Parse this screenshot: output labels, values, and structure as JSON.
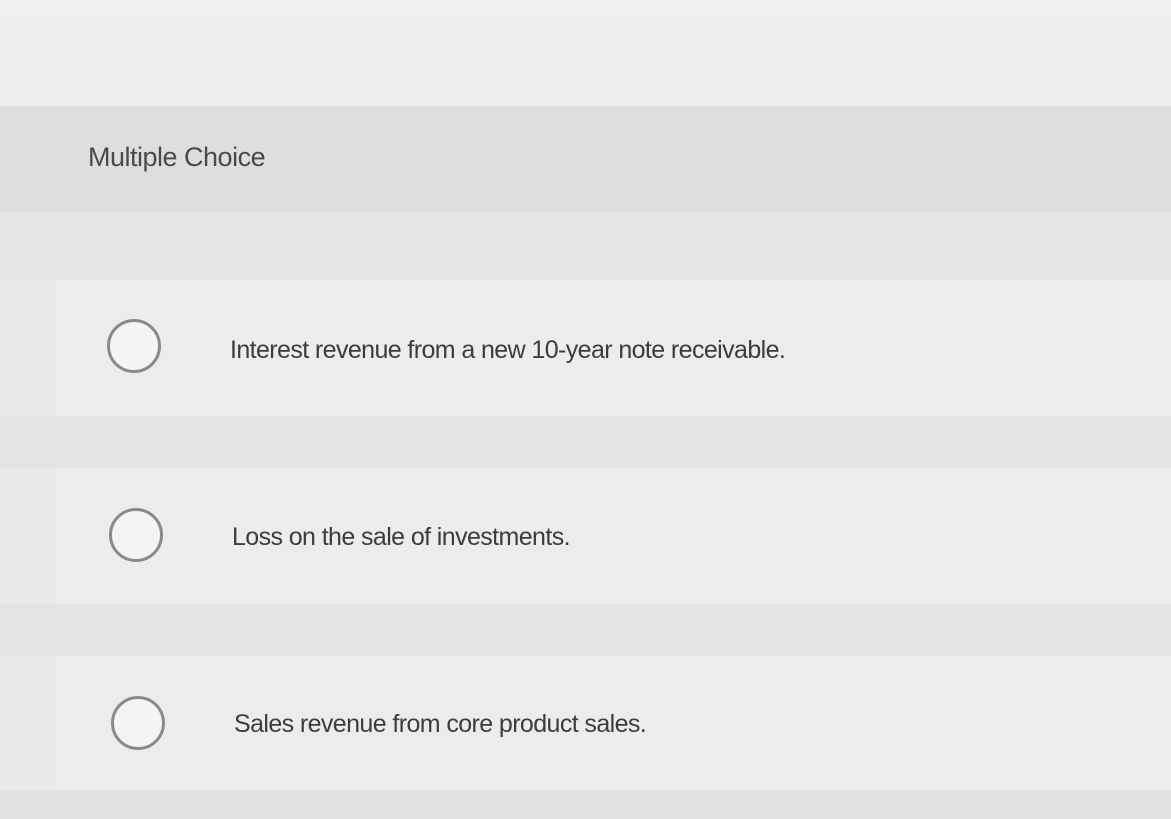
{
  "question": {
    "type_label": "Multiple Choice"
  },
  "options": [
    {
      "label": "Interest revenue from a new 10-year note receivable.",
      "selected": false
    },
    {
      "label": "Loss on the sale of investments.",
      "selected": false
    },
    {
      "label": "Sales revenue from core product sales.",
      "selected": false
    }
  ]
}
